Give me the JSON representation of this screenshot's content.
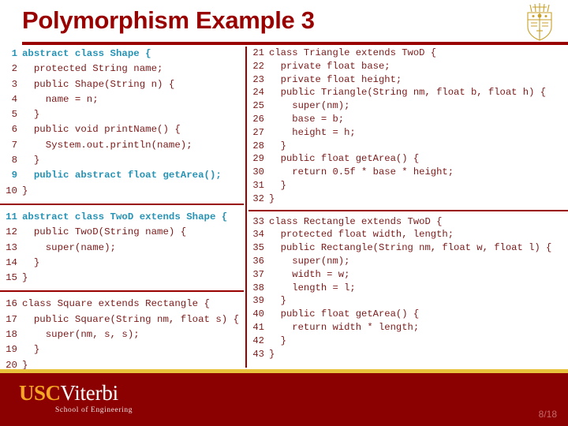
{
  "header": {
    "title": "Polymorphism Example 3",
    "crest_icon": "usc-shield-crest-icon",
    "rule_color": "#990000"
  },
  "theme": {
    "primary_red": "#990000",
    "code_red": "#7b1a1a",
    "highlight_cyan": "#2693b5",
    "gold": "#e8c23a",
    "footer_red": "#8b0000"
  },
  "code": {
    "left_column": {
      "blocks": [
        {
          "lines": [
            {
              "n": "1",
              "text": "abstract class Shape {",
              "highlight": true
            },
            {
              "n": "2",
              "text": "  protected String name;",
              "highlight": false
            },
            {
              "n": "3",
              "text": "  public Shape(String n) {",
              "highlight": false
            },
            {
              "n": "4",
              "text": "    name = n;",
              "highlight": false
            },
            {
              "n": "5",
              "text": "  }",
              "highlight": false
            },
            {
              "n": "6",
              "text": "  public void printName() {",
              "highlight": false
            },
            {
              "n": "7",
              "text": "    System.out.println(name);",
              "highlight": false
            },
            {
              "n": "8",
              "text": "  }",
              "highlight": false
            },
            {
              "n": "9",
              "text": "  public abstract float getArea();",
              "highlight": true
            },
            {
              "n": "10",
              "text": "}",
              "highlight": false
            }
          ]
        },
        {
          "lines": [
            {
              "n": "11",
              "text": "abstract class TwoD extends Shape {",
              "highlight": true
            },
            {
              "n": "12",
              "text": "  public TwoD(String name) {",
              "highlight": false
            },
            {
              "n": "13",
              "text": "    super(name);",
              "highlight": false
            },
            {
              "n": "14",
              "text": "  }",
              "highlight": false
            },
            {
              "n": "15",
              "text": "}",
              "highlight": false
            }
          ]
        },
        {
          "lines": [
            {
              "n": "16",
              "text": "class Square extends Rectangle {",
              "highlight": false
            },
            {
              "n": "17",
              "text": "  public Square(String nm, float s) {",
              "highlight": false
            },
            {
              "n": "18",
              "text": "    super(nm, s, s);",
              "highlight": false
            },
            {
              "n": "19",
              "text": "  }",
              "highlight": false
            },
            {
              "n": "20",
              "text": "}",
              "highlight": false
            }
          ]
        }
      ]
    },
    "right_column": {
      "blocks": [
        {
          "lines": [
            {
              "n": "21",
              "text": "class Triangle extends TwoD {",
              "highlight": false
            },
            {
              "n": "22",
              "text": "  private float base;",
              "highlight": false
            },
            {
              "n": "23",
              "text": "  private float height;",
              "highlight": false
            },
            {
              "n": "24",
              "text": "  public Triangle(String nm, float b, float h) {",
              "highlight": false
            },
            {
              "n": "25",
              "text": "    super(nm);",
              "highlight": false
            },
            {
              "n": "26",
              "text": "    base = b;",
              "highlight": false
            },
            {
              "n": "27",
              "text": "    height = h;",
              "highlight": false
            },
            {
              "n": "28",
              "text": "  }",
              "highlight": false
            },
            {
              "n": "29",
              "text": "  public float getArea() {",
              "highlight": false
            },
            {
              "n": "30",
              "text": "    return 0.5f * base * height;",
              "highlight": false
            },
            {
              "n": "31",
              "text": "  }",
              "highlight": false
            },
            {
              "n": "32",
              "text": "}",
              "highlight": false
            }
          ]
        },
        {
          "lines": [
            {
              "n": "33",
              "text": "class Rectangle extends TwoD {",
              "highlight": false
            },
            {
              "n": "34",
              "text": "  protected float width, length;",
              "highlight": false
            },
            {
              "n": "35",
              "text": "  public Rectangle(String nm, float w, float l) {",
              "highlight": false
            },
            {
              "n": "36",
              "text": "    super(nm);",
              "highlight": false
            },
            {
              "n": "37",
              "text": "    width = w;",
              "highlight": false
            },
            {
              "n": "38",
              "text": "    length = l;",
              "highlight": false
            },
            {
              "n": "39",
              "text": "  }",
              "highlight": false
            },
            {
              "n": "40",
              "text": "  public float getArea() {",
              "highlight": false
            },
            {
              "n": "41",
              "text": "    return width * length;",
              "highlight": false
            },
            {
              "n": "42",
              "text": "  }",
              "highlight": false
            },
            {
              "n": "43",
              "text": "}",
              "highlight": false
            }
          ]
        }
      ]
    }
  },
  "footer": {
    "logo_usc": "USC",
    "logo_viterbi": "Viterbi",
    "logo_subtitle": "School of Engineering",
    "page_number": "8/18"
  }
}
